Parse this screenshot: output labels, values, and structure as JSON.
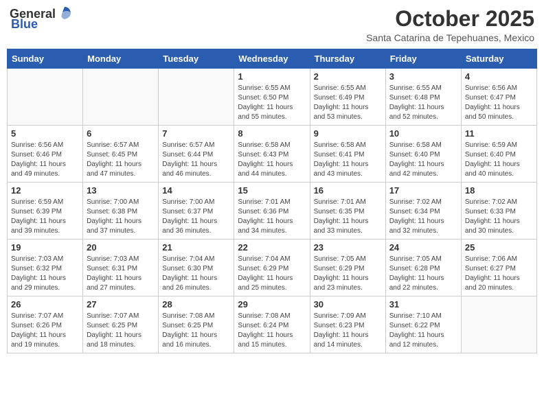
{
  "logo": {
    "general": "General",
    "blue": "Blue"
  },
  "title": "October 2025",
  "location": "Santa Catarina de Tepehuanes, Mexico",
  "days_of_week": [
    "Sunday",
    "Monday",
    "Tuesday",
    "Wednesday",
    "Thursday",
    "Friday",
    "Saturday"
  ],
  "weeks": [
    [
      {
        "day": "",
        "sunrise": "",
        "sunset": "",
        "daylight": ""
      },
      {
        "day": "",
        "sunrise": "",
        "sunset": "",
        "daylight": ""
      },
      {
        "day": "",
        "sunrise": "",
        "sunset": "",
        "daylight": ""
      },
      {
        "day": "1",
        "sunrise": "Sunrise: 6:55 AM",
        "sunset": "Sunset: 6:50 PM",
        "daylight": "Daylight: 11 hours and 55 minutes."
      },
      {
        "day": "2",
        "sunrise": "Sunrise: 6:55 AM",
        "sunset": "Sunset: 6:49 PM",
        "daylight": "Daylight: 11 hours and 53 minutes."
      },
      {
        "day": "3",
        "sunrise": "Sunrise: 6:55 AM",
        "sunset": "Sunset: 6:48 PM",
        "daylight": "Daylight: 11 hours and 52 minutes."
      },
      {
        "day": "4",
        "sunrise": "Sunrise: 6:56 AM",
        "sunset": "Sunset: 6:47 PM",
        "daylight": "Daylight: 11 hours and 50 minutes."
      }
    ],
    [
      {
        "day": "5",
        "sunrise": "Sunrise: 6:56 AM",
        "sunset": "Sunset: 6:46 PM",
        "daylight": "Daylight: 11 hours and 49 minutes."
      },
      {
        "day": "6",
        "sunrise": "Sunrise: 6:57 AM",
        "sunset": "Sunset: 6:45 PM",
        "daylight": "Daylight: 11 hours and 47 minutes."
      },
      {
        "day": "7",
        "sunrise": "Sunrise: 6:57 AM",
        "sunset": "Sunset: 6:44 PM",
        "daylight": "Daylight: 11 hours and 46 minutes."
      },
      {
        "day": "8",
        "sunrise": "Sunrise: 6:58 AM",
        "sunset": "Sunset: 6:43 PM",
        "daylight": "Daylight: 11 hours and 44 minutes."
      },
      {
        "day": "9",
        "sunrise": "Sunrise: 6:58 AM",
        "sunset": "Sunset: 6:41 PM",
        "daylight": "Daylight: 11 hours and 43 minutes."
      },
      {
        "day": "10",
        "sunrise": "Sunrise: 6:58 AM",
        "sunset": "Sunset: 6:40 PM",
        "daylight": "Daylight: 11 hours and 42 minutes."
      },
      {
        "day": "11",
        "sunrise": "Sunrise: 6:59 AM",
        "sunset": "Sunset: 6:40 PM",
        "daylight": "Daylight: 11 hours and 40 minutes."
      }
    ],
    [
      {
        "day": "12",
        "sunrise": "Sunrise: 6:59 AM",
        "sunset": "Sunset: 6:39 PM",
        "daylight": "Daylight: 11 hours and 39 minutes."
      },
      {
        "day": "13",
        "sunrise": "Sunrise: 7:00 AM",
        "sunset": "Sunset: 6:38 PM",
        "daylight": "Daylight: 11 hours and 37 minutes."
      },
      {
        "day": "14",
        "sunrise": "Sunrise: 7:00 AM",
        "sunset": "Sunset: 6:37 PM",
        "daylight": "Daylight: 11 hours and 36 minutes."
      },
      {
        "day": "15",
        "sunrise": "Sunrise: 7:01 AM",
        "sunset": "Sunset: 6:36 PM",
        "daylight": "Daylight: 11 hours and 34 minutes."
      },
      {
        "day": "16",
        "sunrise": "Sunrise: 7:01 AM",
        "sunset": "Sunset: 6:35 PM",
        "daylight": "Daylight: 11 hours and 33 minutes."
      },
      {
        "day": "17",
        "sunrise": "Sunrise: 7:02 AM",
        "sunset": "Sunset: 6:34 PM",
        "daylight": "Daylight: 11 hours and 32 minutes."
      },
      {
        "day": "18",
        "sunrise": "Sunrise: 7:02 AM",
        "sunset": "Sunset: 6:33 PM",
        "daylight": "Daylight: 11 hours and 30 minutes."
      }
    ],
    [
      {
        "day": "19",
        "sunrise": "Sunrise: 7:03 AM",
        "sunset": "Sunset: 6:32 PM",
        "daylight": "Daylight: 11 hours and 29 minutes."
      },
      {
        "day": "20",
        "sunrise": "Sunrise: 7:03 AM",
        "sunset": "Sunset: 6:31 PM",
        "daylight": "Daylight: 11 hours and 27 minutes."
      },
      {
        "day": "21",
        "sunrise": "Sunrise: 7:04 AM",
        "sunset": "Sunset: 6:30 PM",
        "daylight": "Daylight: 11 hours and 26 minutes."
      },
      {
        "day": "22",
        "sunrise": "Sunrise: 7:04 AM",
        "sunset": "Sunset: 6:29 PM",
        "daylight": "Daylight: 11 hours and 25 minutes."
      },
      {
        "day": "23",
        "sunrise": "Sunrise: 7:05 AM",
        "sunset": "Sunset: 6:29 PM",
        "daylight": "Daylight: 11 hours and 23 minutes."
      },
      {
        "day": "24",
        "sunrise": "Sunrise: 7:05 AM",
        "sunset": "Sunset: 6:28 PM",
        "daylight": "Daylight: 11 hours and 22 minutes."
      },
      {
        "day": "25",
        "sunrise": "Sunrise: 7:06 AM",
        "sunset": "Sunset: 6:27 PM",
        "daylight": "Daylight: 11 hours and 20 minutes."
      }
    ],
    [
      {
        "day": "26",
        "sunrise": "Sunrise: 7:07 AM",
        "sunset": "Sunset: 6:26 PM",
        "daylight": "Daylight: 11 hours and 19 minutes."
      },
      {
        "day": "27",
        "sunrise": "Sunrise: 7:07 AM",
        "sunset": "Sunset: 6:25 PM",
        "daylight": "Daylight: 11 hours and 18 minutes."
      },
      {
        "day": "28",
        "sunrise": "Sunrise: 7:08 AM",
        "sunset": "Sunset: 6:25 PM",
        "daylight": "Daylight: 11 hours and 16 minutes."
      },
      {
        "day": "29",
        "sunrise": "Sunrise: 7:08 AM",
        "sunset": "Sunset: 6:24 PM",
        "daylight": "Daylight: 11 hours and 15 minutes."
      },
      {
        "day": "30",
        "sunrise": "Sunrise: 7:09 AM",
        "sunset": "Sunset: 6:23 PM",
        "daylight": "Daylight: 11 hours and 14 minutes."
      },
      {
        "day": "31",
        "sunrise": "Sunrise: 7:10 AM",
        "sunset": "Sunset: 6:22 PM",
        "daylight": "Daylight: 11 hours and 12 minutes."
      },
      {
        "day": "",
        "sunrise": "",
        "sunset": "",
        "daylight": ""
      }
    ]
  ]
}
